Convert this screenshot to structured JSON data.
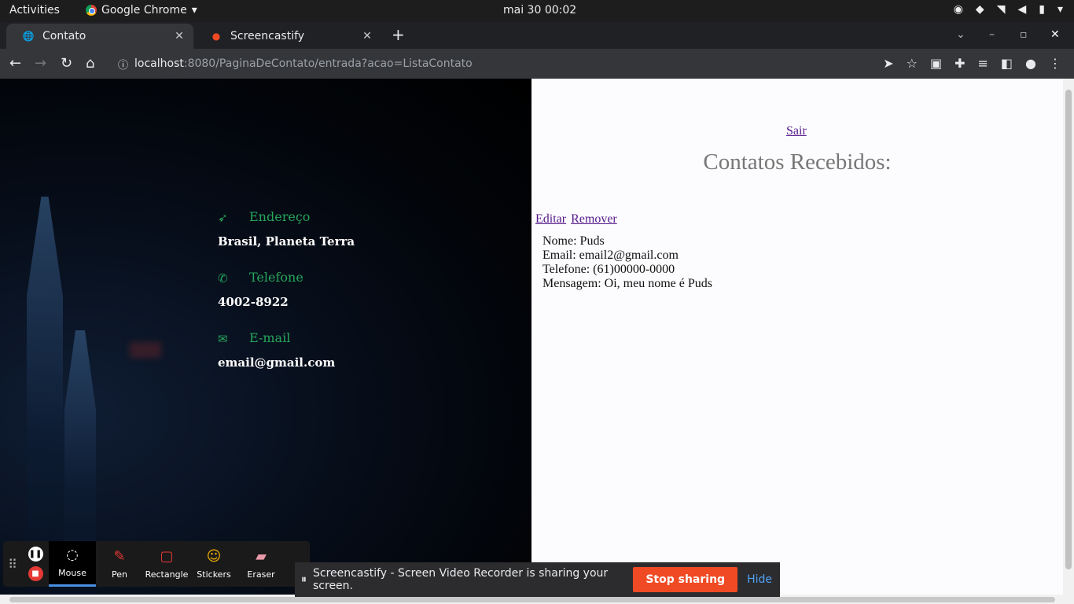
{
  "system_bar": {
    "activities": "Activities",
    "app_name": "Google Chrome",
    "clock": "mai 30  00:02"
  },
  "browser": {
    "tabs": [
      {
        "title": "Contato",
        "active": true
      },
      {
        "title": "Screencastify",
        "active": false
      }
    ],
    "url_host": "localhost",
    "url_rest": ":8080/PaginaDeContato/entrada?acao=ListaContato"
  },
  "contact_info": {
    "address_label": "Endereço",
    "address_value": "Brasil, Planeta Terra",
    "phone_label": "Telefone",
    "phone_value": "4002-8922",
    "email_label": "E-mail",
    "email_value": "email@gmail.com"
  },
  "contacts_page": {
    "logout_link": "Sair",
    "heading": "Contatos Recebidos:",
    "edit_link": "Editar",
    "remove_link": "Remover",
    "entry": {
      "name": "Nome: Puds",
      "email": "Email: email2@gmail.com",
      "phone": "Telefone: (61)00000-0000",
      "message": "Mensagem: Oi, meu nome é Puds"
    }
  },
  "screencastify_tools": {
    "tools": [
      "Mouse",
      "Pen",
      "Rectangle",
      "Stickers",
      "Eraser"
    ]
  },
  "share_bar": {
    "message": "Screencastify - Screen Video Recorder is sharing your screen.",
    "stop_label": "Stop sharing",
    "hide_label": "Hide"
  },
  "colors": {
    "accent_green": "#26a65b",
    "stop_button": "#f04a24",
    "link_visited": "#551a8b"
  }
}
